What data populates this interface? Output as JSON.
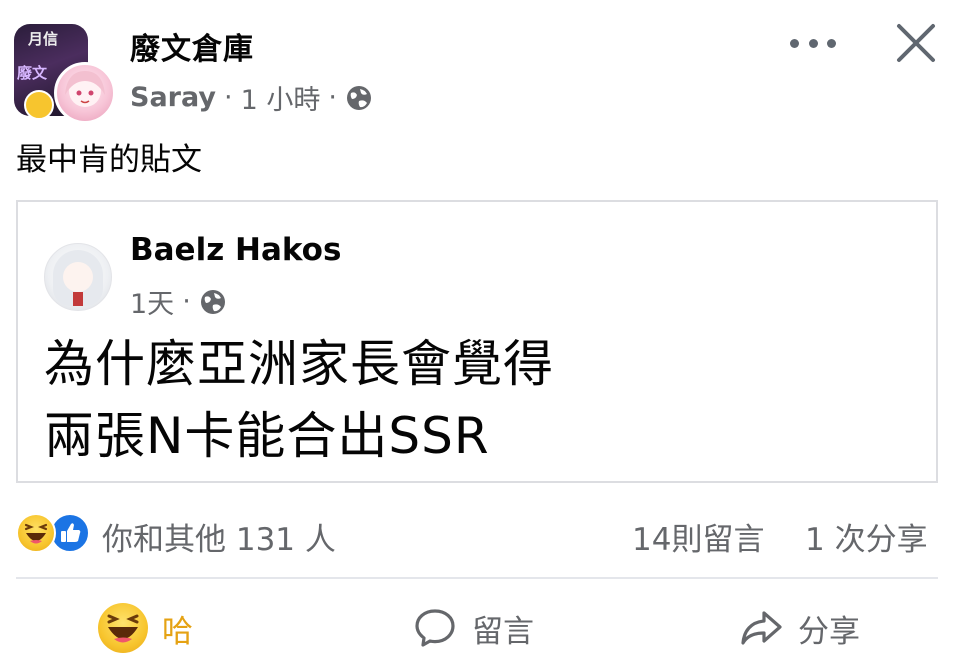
{
  "post": {
    "group_name": "廢文倉庫",
    "author": "Saray",
    "time": "1 小時",
    "separator": "·",
    "text": "最中肯的貼文",
    "group_avatar_text_top": "月信",
    "group_avatar_text": "廢文"
  },
  "shared_post": {
    "author": "Baelz Hakos",
    "time": "1天",
    "separator": "·",
    "line1": "為什麼亞洲家長會覺得",
    "line2": "兩張N卡能合出SSR"
  },
  "stats": {
    "reactions_text": "你和其他 131 人",
    "comments": "14則留言",
    "shares": "1 次分享"
  },
  "actions": {
    "haha": "哈",
    "comment": "留言",
    "share": "分享"
  },
  "icons": {
    "more": "more-dots-icon",
    "close": "close-icon",
    "globe": "globe-icon",
    "haha": "haha-reaction-icon",
    "like": "like-reaction-icon",
    "comment": "comment-bubble-icon",
    "share": "share-arrow-icon"
  },
  "colors": {
    "text_primary": "#050505",
    "text_secondary": "#65676b",
    "haha_yellow": "#f7c52e",
    "haha_label": "#e5a213",
    "like_blue": "#1b74e4",
    "divider": "#e4e6eb",
    "card_border": "#dcdde1"
  }
}
